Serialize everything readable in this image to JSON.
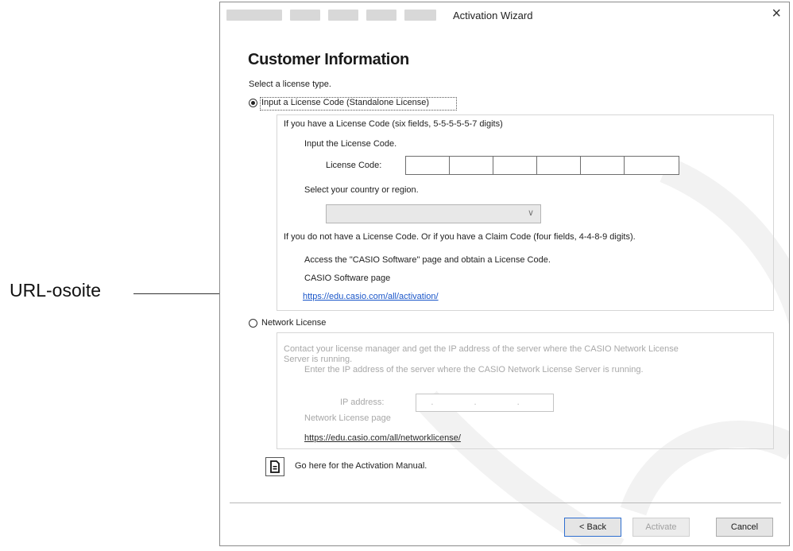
{
  "callout": {
    "label": "URL-osoite"
  },
  "window": {
    "title": "Activation Wizard",
    "close_glyph": "×"
  },
  "heading": "Customer Information",
  "prompt": "Select a license type.",
  "standalone": {
    "option_label": "Input a License Code (Standalone License)",
    "selected": true,
    "have_code_text": "If you have a License Code (six fields, 5-5-5-5-5-7 digits)",
    "input_instruction": "Input the License Code.",
    "code_label": "License Code:",
    "code_fields": [
      "",
      "",
      "",
      "",
      "",
      ""
    ],
    "country_instruction": "Select your country or region.",
    "country_value": "",
    "no_code_text": "If you do not have a License Code. Or if you have a Claim Code (four fields, 4-4-8-9 digits).",
    "access_text": "Access the \"CASIO Software\" page and obtain a License Code.",
    "software_page_label": "CASIO Software page",
    "activation_url": "https://edu.casio.com/all/activation/"
  },
  "network": {
    "option_label": "Network License",
    "selected": false,
    "contact_text_line1": "Contact your license manager and get the IP address of the server where the CASIO Network License",
    "contact_text_line2": "Server is running.",
    "enter_ip_text": "Enter the IP address of the server where the CASIO Network License Server is running.",
    "ip_label": "IP address:",
    "ip_value": ". . .",
    "page_label": "Network License page",
    "url": "https://edu.casio.com/all/networklicense/"
  },
  "manual": {
    "icon": "document-icon",
    "label": "Go here for the Activation Manual."
  },
  "buttons": {
    "back": "< Back",
    "activate": "Activate",
    "cancel": "Cancel"
  },
  "colors": {
    "link": "#1a56c9",
    "focus_border": "#2f6fd1",
    "watermark": "#f3f3f3"
  }
}
